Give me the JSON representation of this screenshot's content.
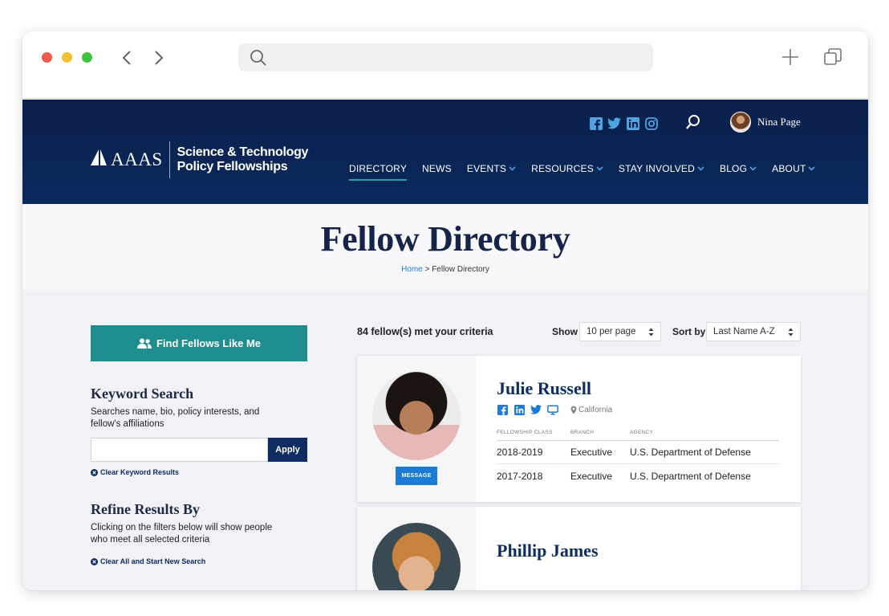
{
  "browser": {
    "url": ""
  },
  "site": {
    "logo": {
      "mark": "AAAS",
      "text_line1": "Science & Technology",
      "text_line2": "Policy Fellowships"
    },
    "social": [
      "facebook-icon",
      "twitter-icon",
      "linkedin-icon",
      "instagram-icon"
    ],
    "user": {
      "name": "Nina Page"
    },
    "nav": [
      {
        "label": "DIRECTORY",
        "active": true,
        "dropdown": false
      },
      {
        "label": "NEWS",
        "dropdown": false
      },
      {
        "label": "EVENTS",
        "dropdown": true
      },
      {
        "label": "RESOURCES",
        "dropdown": true
      },
      {
        "label": "STAY INVOLVED",
        "dropdown": true
      },
      {
        "label": "BLOG",
        "dropdown": true
      },
      {
        "label": "ABOUT",
        "dropdown": true
      }
    ],
    "colors": {
      "header": "#0b1f4a",
      "teal": "#1f8e8e",
      "navy": "#0e2d63",
      "link": "#1b7bd6"
    }
  },
  "hero": {
    "title": "Fellow Directory",
    "breadcrumb": {
      "home": "Home",
      "separator": " > ",
      "current": "Fellow Directory"
    }
  },
  "sidebar": {
    "find_button": "Find Fellows Like Me",
    "keyword": {
      "heading": "Keyword Search",
      "description": "Searches name, bio, policy interests, and fellow's affiliations",
      "value": "",
      "placeholder": "",
      "apply": "Apply",
      "clear": "Clear Keyword Results"
    },
    "refine": {
      "heading": "Refine Results By",
      "description": "Clicking on the filters below will show people who meet all selected criteria",
      "clear_all": "Clear All and Start New Search"
    }
  },
  "results": {
    "count_text": "84 fellow(s) met your criteria",
    "show_label": "Show",
    "show_value": "10 per page",
    "sort_label": "Sort by",
    "sort_value": "Last Name A-Z",
    "table_headers": {
      "class": "FELLOWSHIP CLASS",
      "branch": "BRANCH",
      "agency": "AGENCY"
    },
    "fellows": [
      {
        "name": "Julie Russell",
        "location": "California",
        "message": "MESSAGE",
        "rows": [
          {
            "class": "2018-2019",
            "branch": "Executive",
            "agency": "U.S. Department of Defense"
          },
          {
            "class": "2017-2018",
            "branch": "Executive",
            "agency": "U.S. Department of Defense"
          }
        ]
      },
      {
        "name": "Phillip James"
      }
    ]
  }
}
